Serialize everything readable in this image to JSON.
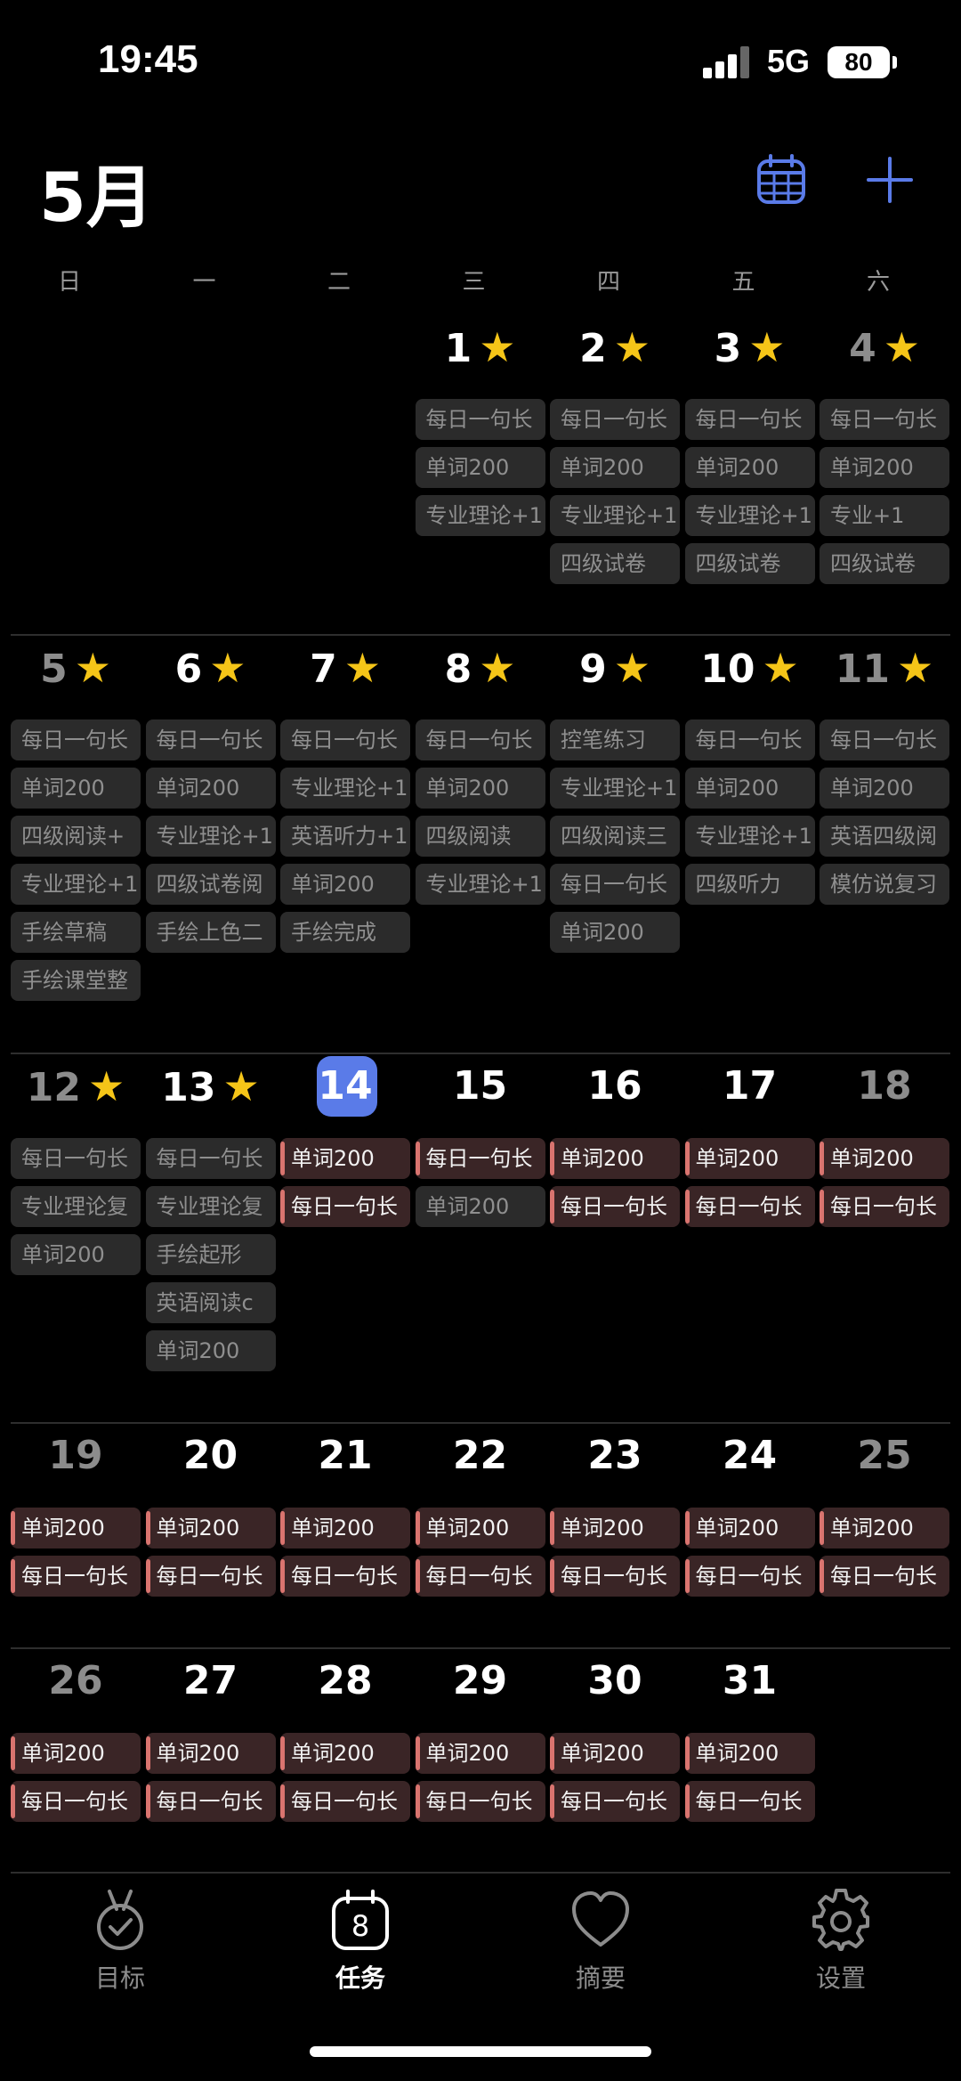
{
  "status": {
    "time": "19:45",
    "network": "5G",
    "battery": "80"
  },
  "header": {
    "title": "5月",
    "calendar_icon": "calendar-grid-icon",
    "add_icon": "plus-icon",
    "accent": "#5a7be8"
  },
  "weekdays": [
    "日",
    "一",
    "二",
    "三",
    "四",
    "五",
    "六"
  ],
  "colors": {
    "done_chip": "#2b2b2b",
    "todo_chip": "#3a2526",
    "todo_marker": "#d9746f",
    "star": "#f5c518"
  },
  "weeks": [
    {
      "days": [
        {
          "col": 3,
          "day": "1",
          "star": true,
          "tasks": [
            {
              "t": "每日一句长",
              "s": "done"
            },
            {
              "t": "单词200",
              "s": "done"
            },
            {
              "t": "专业理论+1",
              "s": "done"
            }
          ]
        },
        {
          "col": 4,
          "day": "2",
          "star": true,
          "tasks": [
            {
              "t": "每日一句长",
              "s": "done"
            },
            {
              "t": "单词200",
              "s": "done"
            },
            {
              "t": "专业理论+1",
              "s": "done"
            },
            {
              "t": "四级试卷",
              "s": "done"
            }
          ]
        },
        {
          "col": 5,
          "day": "3",
          "star": true,
          "tasks": [
            {
              "t": "每日一句长",
              "s": "done"
            },
            {
              "t": "单词200",
              "s": "done"
            },
            {
              "t": "专业理论+1",
              "s": "done"
            },
            {
              "t": "四级试卷",
              "s": "done"
            }
          ]
        },
        {
          "col": 6,
          "day": "4",
          "star": true,
          "dim": true,
          "tasks": [
            {
              "t": "每日一句长",
              "s": "done"
            },
            {
              "t": "单词200",
              "s": "done"
            },
            {
              "t": "专业+1",
              "s": "done"
            },
            {
              "t": "四级试卷",
              "s": "done"
            }
          ]
        }
      ]
    },
    {
      "days": [
        {
          "col": 0,
          "day": "5",
          "star": true,
          "dim": true,
          "tasks": [
            {
              "t": "每日一句长",
              "s": "done"
            },
            {
              "t": "单词200",
              "s": "done"
            },
            {
              "t": "四级阅读+",
              "s": "done"
            },
            {
              "t": "专业理论+1",
              "s": "done"
            },
            {
              "t": "手绘草稿",
              "s": "done"
            },
            {
              "t": "手绘课堂整",
              "s": "done"
            }
          ]
        },
        {
          "col": 1,
          "day": "6",
          "star": true,
          "tasks": [
            {
              "t": "每日一句长",
              "s": "done"
            },
            {
              "t": "单词200",
              "s": "done"
            },
            {
              "t": "专业理论+1",
              "s": "done"
            },
            {
              "t": "四级试卷阅",
              "s": "done"
            },
            {
              "t": "手绘上色二",
              "s": "done"
            }
          ]
        },
        {
          "col": 2,
          "day": "7",
          "star": true,
          "tasks": [
            {
              "t": "每日一句长",
              "s": "done"
            },
            {
              "t": "专业理论+1",
              "s": "done"
            },
            {
              "t": "英语听力+1",
              "s": "done"
            },
            {
              "t": "单词200",
              "s": "done"
            },
            {
              "t": "手绘完成",
              "s": "done"
            }
          ]
        },
        {
          "col": 3,
          "day": "8",
          "star": true,
          "tasks": [
            {
              "t": "每日一句长",
              "s": "done"
            },
            {
              "t": "单词200",
              "s": "done"
            },
            {
              "t": "四级阅读",
              "s": "done"
            },
            {
              "t": "专业理论+1",
              "s": "done"
            }
          ]
        },
        {
          "col": 4,
          "day": "9",
          "star": true,
          "tasks": [
            {
              "t": "控笔练习",
              "s": "done"
            },
            {
              "t": "专业理论+1",
              "s": "done"
            },
            {
              "t": "四级阅读三",
              "s": "done"
            },
            {
              "t": "每日一句长",
              "s": "done"
            },
            {
              "t": "单词200",
              "s": "done"
            }
          ]
        },
        {
          "col": 5,
          "day": "10",
          "star": true,
          "tasks": [
            {
              "t": "每日一句长",
              "s": "done"
            },
            {
              "t": "单词200",
              "s": "done"
            },
            {
              "t": "专业理论+1",
              "s": "done"
            },
            {
              "t": "四级听力",
              "s": "done"
            }
          ]
        },
        {
          "col": 6,
          "day": "11",
          "star": true,
          "dim": true,
          "tasks": [
            {
              "t": "每日一句长",
              "s": "done"
            },
            {
              "t": "单词200",
              "s": "done"
            },
            {
              "t": "英语四级阅",
              "s": "done"
            },
            {
              "t": "模仿说复习",
              "s": "done"
            }
          ]
        }
      ]
    },
    {
      "days": [
        {
          "col": 0,
          "day": "12",
          "star": true,
          "dim": true,
          "tasks": [
            {
              "t": "每日一句长",
              "s": "done"
            },
            {
              "t": "专业理论复",
              "s": "done"
            },
            {
              "t": "单词200",
              "s": "done"
            }
          ]
        },
        {
          "col": 1,
          "day": "13",
          "star": true,
          "tasks": [
            {
              "t": "每日一句长",
              "s": "done"
            },
            {
              "t": "专业理论复",
              "s": "done"
            },
            {
              "t": "手绘起形",
              "s": "done"
            },
            {
              "t": "英语阅读c",
              "s": "done"
            },
            {
              "t": "单词200",
              "s": "done"
            }
          ]
        },
        {
          "col": 2,
          "day": "14",
          "today": true,
          "tasks": [
            {
              "t": "单词200",
              "s": "todo"
            },
            {
              "t": "每日一句长",
              "s": "todo"
            }
          ]
        },
        {
          "col": 3,
          "day": "15",
          "tasks": [
            {
              "t": "每日一句长",
              "s": "todo"
            },
            {
              "t": "单词200",
              "s": "done"
            }
          ]
        },
        {
          "col": 4,
          "day": "16",
          "tasks": [
            {
              "t": "单词200",
              "s": "todo"
            },
            {
              "t": "每日一句长",
              "s": "todo"
            }
          ]
        },
        {
          "col": 5,
          "day": "17",
          "tasks": [
            {
              "t": "单词200",
              "s": "todo"
            },
            {
              "t": "每日一句长",
              "s": "todo"
            }
          ]
        },
        {
          "col": 6,
          "day": "18",
          "dim": true,
          "tasks": [
            {
              "t": "单词200",
              "s": "todo"
            },
            {
              "t": "每日一句长",
              "s": "todo"
            }
          ]
        }
      ]
    },
    {
      "days": [
        {
          "col": 0,
          "day": "19",
          "dim": true,
          "tasks": [
            {
              "t": "单词200",
              "s": "todo"
            },
            {
              "t": "每日一句长",
              "s": "todo"
            }
          ]
        },
        {
          "col": 1,
          "day": "20",
          "tasks": [
            {
              "t": "单词200",
              "s": "todo"
            },
            {
              "t": "每日一句长",
              "s": "todo"
            }
          ]
        },
        {
          "col": 2,
          "day": "21",
          "tasks": [
            {
              "t": "单词200",
              "s": "todo"
            },
            {
              "t": "每日一句长",
              "s": "todo"
            }
          ]
        },
        {
          "col": 3,
          "day": "22",
          "tasks": [
            {
              "t": "单词200",
              "s": "todo"
            },
            {
              "t": "每日一句长",
              "s": "todo"
            }
          ]
        },
        {
          "col": 4,
          "day": "23",
          "tasks": [
            {
              "t": "单词200",
              "s": "todo"
            },
            {
              "t": "每日一句长",
              "s": "todo"
            }
          ]
        },
        {
          "col": 5,
          "day": "24",
          "tasks": [
            {
              "t": "单词200",
              "s": "todo"
            },
            {
              "t": "每日一句长",
              "s": "todo"
            }
          ]
        },
        {
          "col": 6,
          "day": "25",
          "dim": true,
          "tasks": [
            {
              "t": "单词200",
              "s": "todo"
            },
            {
              "t": "每日一句长",
              "s": "todo"
            }
          ]
        }
      ]
    },
    {
      "days": [
        {
          "col": 0,
          "day": "26",
          "dim": true,
          "tasks": [
            {
              "t": "单词200",
              "s": "todo"
            },
            {
              "t": "每日一句长",
              "s": "todo"
            }
          ]
        },
        {
          "col": 1,
          "day": "27",
          "tasks": [
            {
              "t": "单词200",
              "s": "todo"
            },
            {
              "t": "每日一句长",
              "s": "todo"
            }
          ]
        },
        {
          "col": 2,
          "day": "28",
          "tasks": [
            {
              "t": "单词200",
              "s": "todo"
            },
            {
              "t": "每日一句长",
              "s": "todo"
            }
          ]
        },
        {
          "col": 3,
          "day": "29",
          "tasks": [
            {
              "t": "单词200",
              "s": "todo"
            },
            {
              "t": "每日一句长",
              "s": "todo"
            }
          ]
        },
        {
          "col": 4,
          "day": "30",
          "tasks": [
            {
              "t": "单词200",
              "s": "todo"
            },
            {
              "t": "每日一句长",
              "s": "todo"
            }
          ]
        },
        {
          "col": 5,
          "day": "31",
          "tasks": [
            {
              "t": "单词200",
              "s": "todo"
            },
            {
              "t": "每日一句长",
              "s": "todo"
            }
          ]
        }
      ]
    }
  ],
  "tabbar": [
    {
      "label": "目标",
      "icon": "medal-icon",
      "active": false
    },
    {
      "label": "任务",
      "icon": "calendar-8-icon",
      "active": true,
      "icon_text": "8"
    },
    {
      "label": "摘要",
      "icon": "heart-icon",
      "active": false
    },
    {
      "label": "设置",
      "icon": "gear-icon",
      "active": false
    }
  ]
}
